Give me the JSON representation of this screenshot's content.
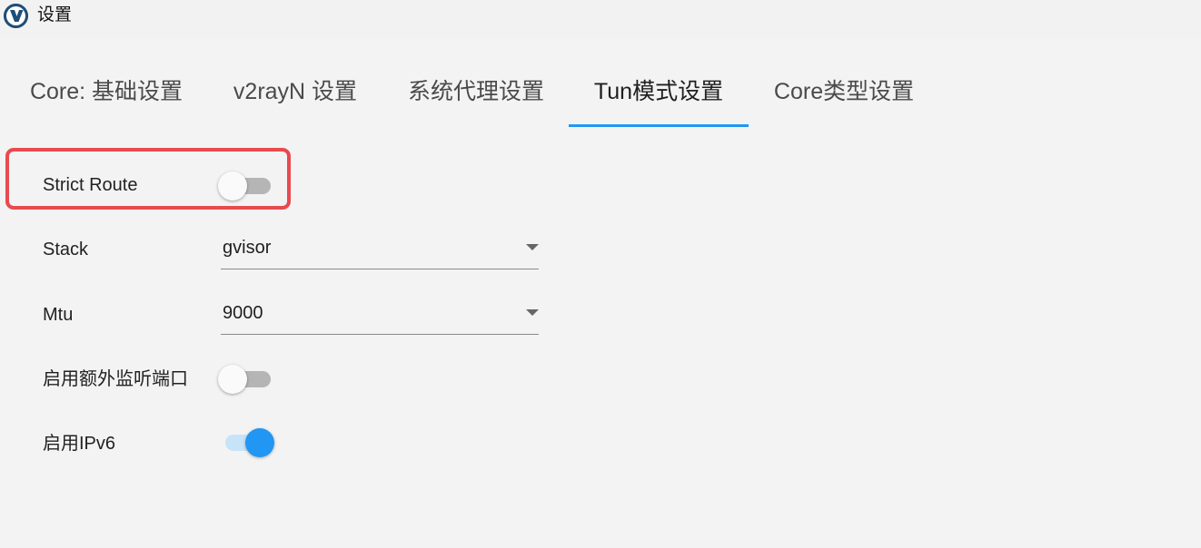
{
  "window": {
    "title": "设置",
    "icon": "v2rayn-logo-icon",
    "icon_letter": "V"
  },
  "tabs": [
    {
      "label": "Core: 基础设置",
      "active": false
    },
    {
      "label": "v2rayN 设置",
      "active": false
    },
    {
      "label": "系统代理设置",
      "active": false
    },
    {
      "label": "Tun模式设置",
      "active": true
    },
    {
      "label": "Core类型设置",
      "active": false
    }
  ],
  "settings": {
    "strict_route": {
      "label": "Strict Route",
      "enabled": false
    },
    "stack": {
      "label": "Stack",
      "value": "gvisor"
    },
    "mtu": {
      "label": "Mtu",
      "value": "9000"
    },
    "extra_listen_port": {
      "label": "启用额外监听端口",
      "enabled": false
    },
    "ipv6": {
      "label": "启用IPv6",
      "enabled": true
    }
  },
  "colors": {
    "accent": "#2196f3",
    "highlight_border": "#e84a4f",
    "toggle_off_track": "#b5b5b5",
    "toggle_on_track": "#c7e3f8"
  }
}
